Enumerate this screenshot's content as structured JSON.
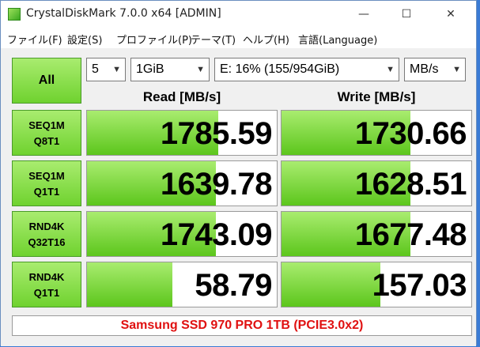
{
  "window": {
    "title": "CrystalDiskMark 7.0.0 x64 [ADMIN]",
    "controls": {
      "minimize": "—",
      "maximize": "☐",
      "close": "✕"
    }
  },
  "menu": [
    "ファイル(F)",
    "設定(S)",
    "プロファイル(P)",
    "テーマ(T)",
    "ヘルプ(H)",
    "言語(Language)"
  ],
  "toolbar": {
    "all_label": "All",
    "count": "5",
    "size": "1GiB",
    "drive": "E: 16% (155/954GiB)",
    "unit": "MB/s"
  },
  "headers": {
    "read": "Read [MB/s]",
    "write": "Write [MB/s]"
  },
  "tests": [
    {
      "line1": "SEQ1M",
      "line2": "Q8T1",
      "read": "1785.59",
      "write": "1730.66",
      "read_fill": 0.69,
      "write_fill": 0.68
    },
    {
      "line1": "SEQ1M",
      "line2": "Q1T1",
      "read": "1639.78",
      "write": "1628.51",
      "read_fill": 0.68,
      "write_fill": 0.68
    },
    {
      "line1": "RND4K",
      "line2": "Q32T16",
      "read": "1743.09",
      "write": "1677.48",
      "read_fill": 0.68,
      "write_fill": 0.68
    },
    {
      "line1": "RND4K",
      "line2": "Q1T1",
      "read": "58.79",
      "write": "157.03",
      "read_fill": 0.45,
      "write_fill": 0.52
    }
  ],
  "comment": "Samsung SSD 970 PRO 1TB (PCIE3.0x2)",
  "colors": {
    "accent_green": "#6fd22f",
    "comment_red": "#e01010"
  }
}
